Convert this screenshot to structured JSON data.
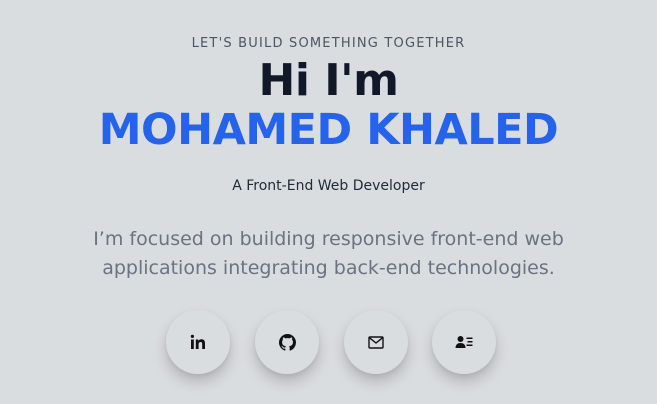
{
  "hero": {
    "tagline": "LET'S BUILD SOMETHING TOGETHER",
    "greeting": "Hi I'm",
    "name": "MOHAMED KHALED",
    "role": "A Front-End Web Developer",
    "description": "I’m focused on building responsive front-end web applications integrating back-end technologies."
  },
  "socials": [
    {
      "icon": "linkedin-icon"
    },
    {
      "icon": "github-icon"
    },
    {
      "icon": "email-icon"
    },
    {
      "icon": "contact-card-icon"
    }
  ],
  "colors": {
    "background": "#dadddf",
    "accent": "#2563eb",
    "heading": "#111827",
    "muted": "#6b7280"
  }
}
